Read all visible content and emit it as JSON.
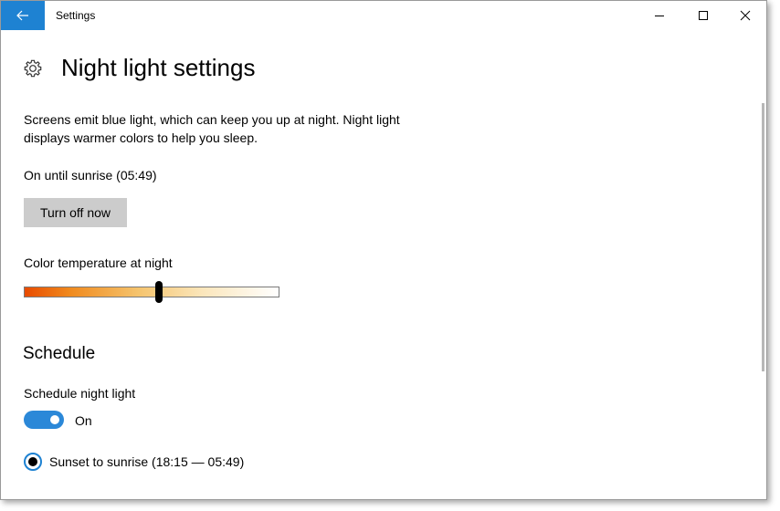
{
  "window": {
    "title": "Settings"
  },
  "page": {
    "title": "Night light settings",
    "description": "Screens emit blue light, which can keep you up at night. Night light displays warmer colors to help you sleep.",
    "status": "On until sunrise (05:49)",
    "turn_off_label": "Turn off now",
    "color_temp_label": "Color temperature at night",
    "color_temp_level": 0.53
  },
  "schedule": {
    "heading": "Schedule",
    "label": "Schedule night light",
    "toggle_state": "On",
    "toggle_on": true,
    "option_label": "Sunset to sunrise (18:15 — 05:49)",
    "option_selected": true
  },
  "colors": {
    "accent": "#1e82d2",
    "toggle_on": "#2b88d8",
    "button_bg": "#cccccc"
  },
  "icons": {
    "back": "arrow-left-icon",
    "settings": "gear-icon",
    "minimize": "minimize-icon",
    "maximize": "maximize-icon",
    "close": "close-icon"
  }
}
